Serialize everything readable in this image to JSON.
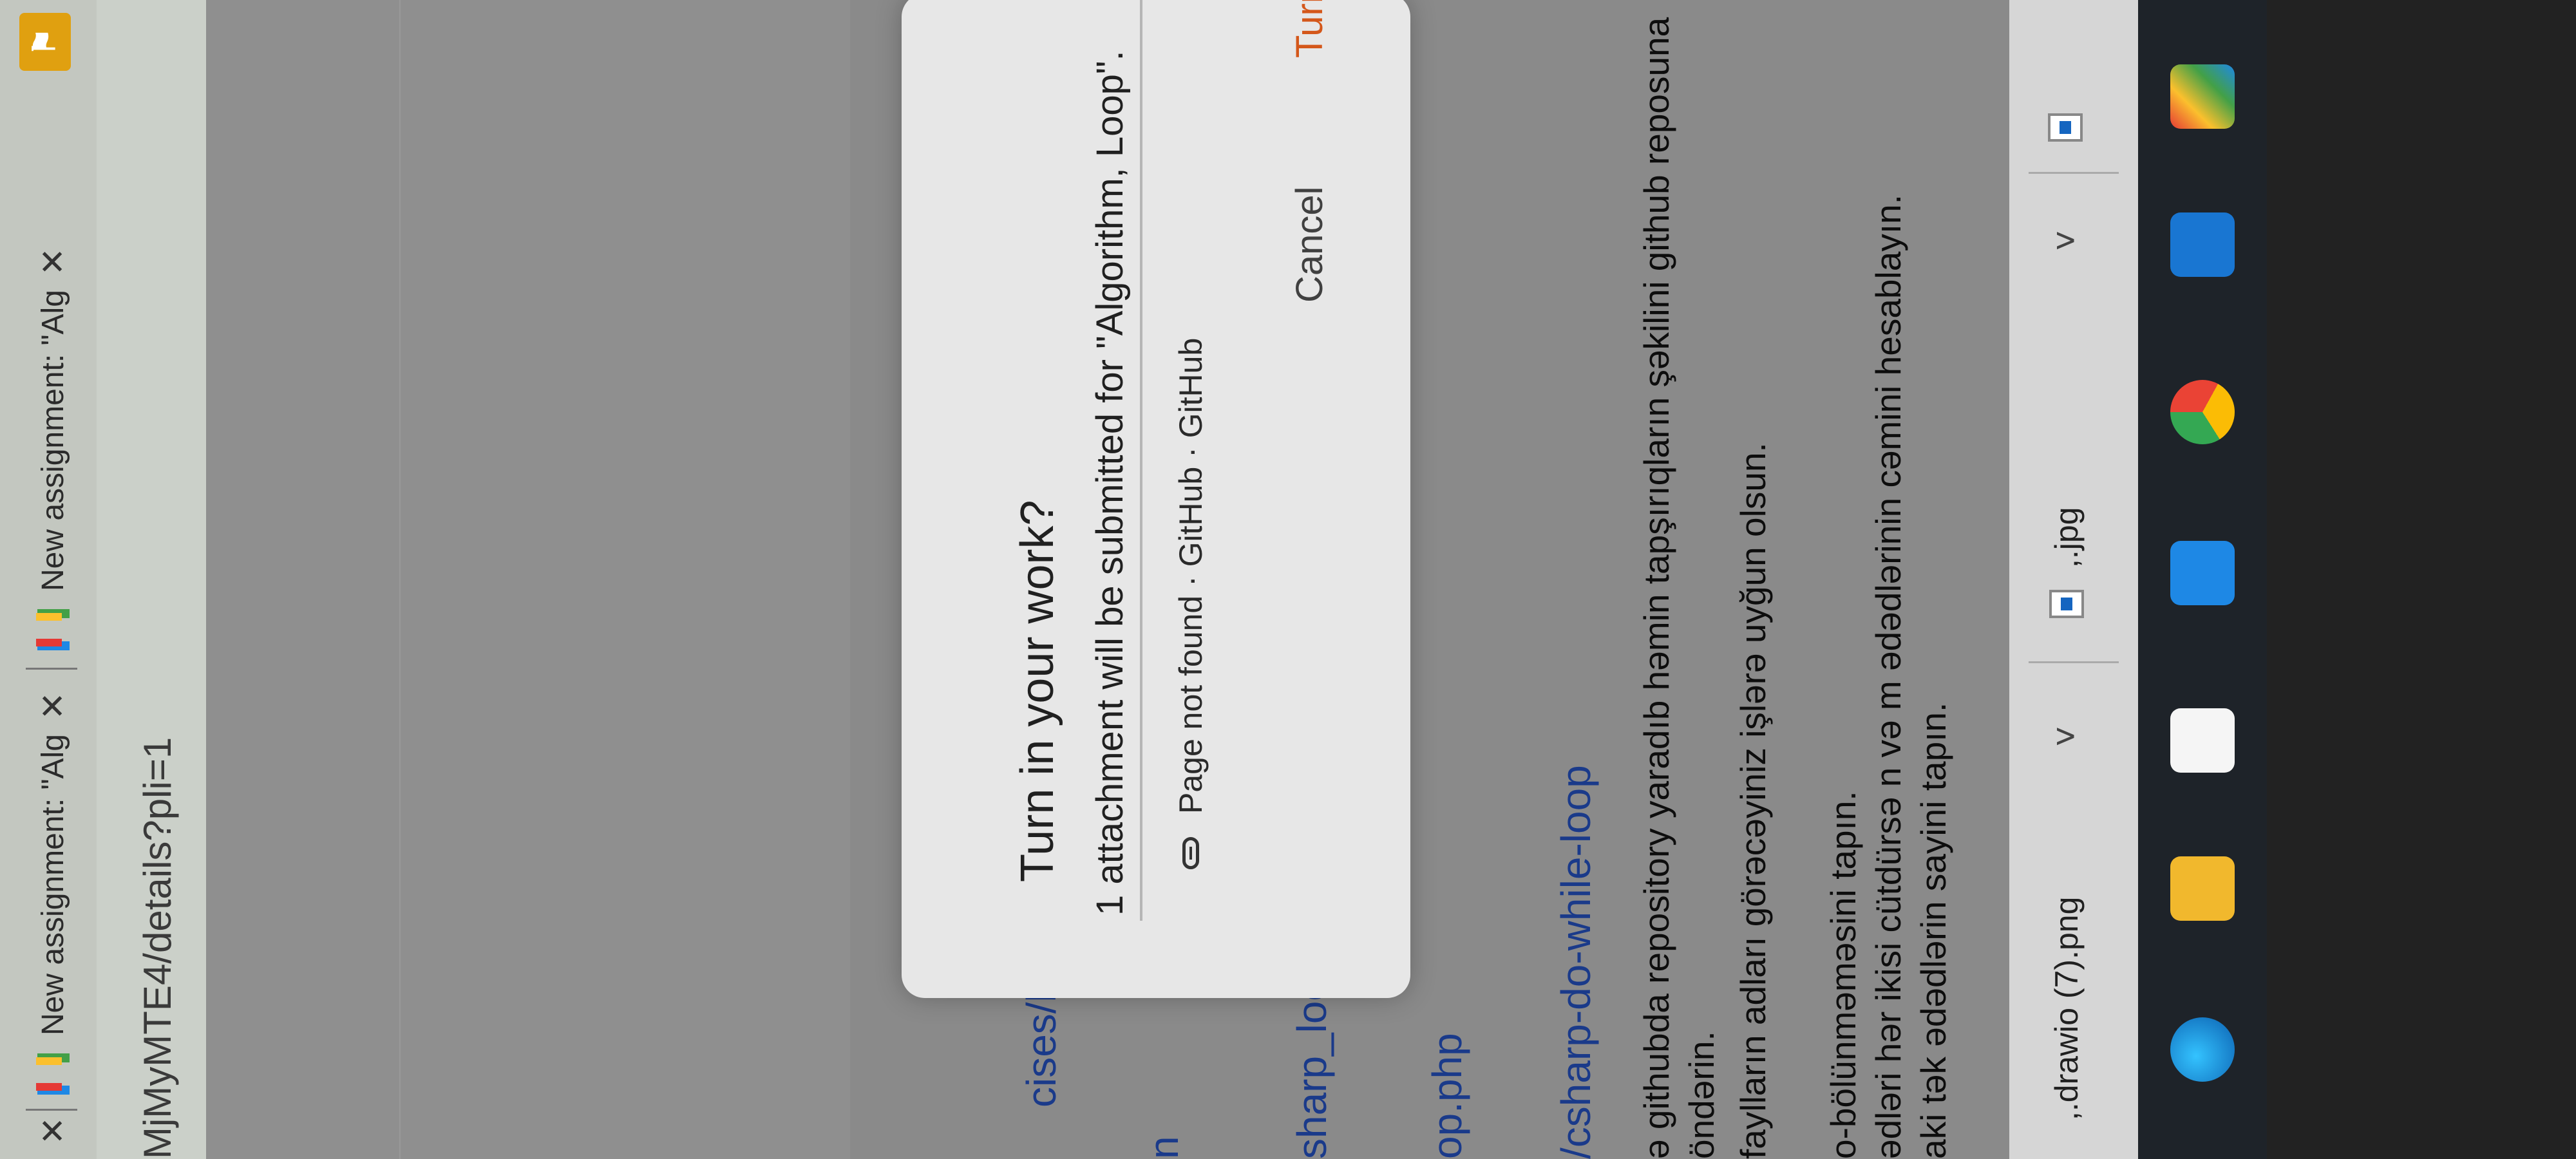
{
  "tabs": [
    {
      "label": "New assignment: \"Alg",
      "close": "✕"
    },
    {
      "label": "New assignment: \"Alg",
      "close": "✕"
    }
  ],
  "first_tab_close": "✕",
  "address": {
    "url": "MjMyMTE4/details?pli=1"
  },
  "background_fragments": {
    "f1": "cises/ba",
    "f2": "n",
    "f3": "sharp_loo",
    "f4": "op.php",
    "f5": "/csharp-do-while-loop"
  },
  "instructions": {
    "line1": "ə githubda repository yaradıb həmin tapşırıqların şəkilini github reposuna",
    "line2": "öndərin.",
    "line3": "faylların adları görəcəyiniz işlərə uyğun olsun.",
    "line4": "o-bölünməməsini tapın.",
    "line5": "ədləri hər ikisi cütdürsə n və m ədədlərinin cəmini hesablayın.",
    "line6": "aki tək ədədlərin sayini tapın."
  },
  "dialog": {
    "title": "Turn in your work?",
    "message": "1 attachment will be submitted for \"Algorithm, Loop\".",
    "attachment": "Page not found · GitHub · GitHub",
    "cancel": "Cancel",
    "turn_in": "Turn in",
    "accent_color": "#d4571a"
  },
  "downloads": [
    {
      "name": ",.drawio (7).png"
    },
    {
      "name": ",.jpg"
    }
  ],
  "taskbar_icons": [
    "edge-icon",
    "file-explorer-icon",
    "store-icon",
    "mail-icon",
    "chrome-icon",
    "photos-icon",
    "git-icon"
  ]
}
